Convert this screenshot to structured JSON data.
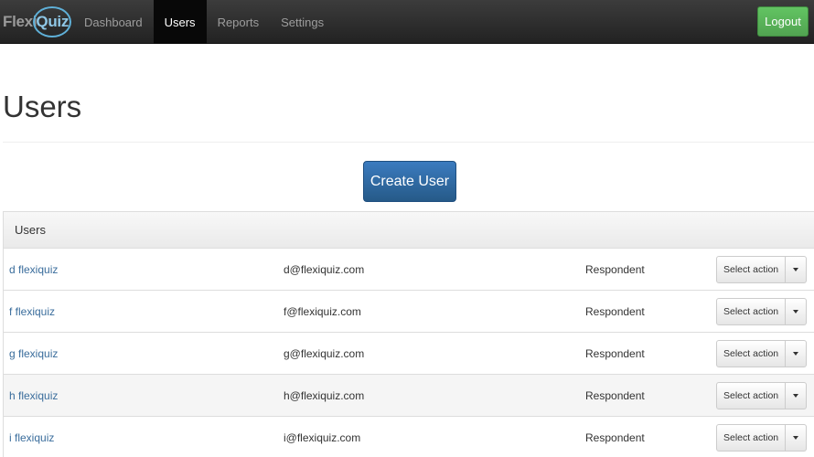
{
  "navbar": {
    "brand_part1": "Flexi",
    "brand_part2": "Quiz",
    "items": [
      {
        "label": "Dashboard",
        "active": false
      },
      {
        "label": "Users",
        "active": true
      },
      {
        "label": "Reports",
        "active": false
      },
      {
        "label": "Settings",
        "active": false
      }
    ],
    "logout_label": "Logout"
  },
  "page": {
    "title": "Users",
    "create_button": "Create User"
  },
  "panel": {
    "heading": "Users",
    "rows": [
      {
        "name": "d flexiquiz",
        "email": "d@flexiquiz.com",
        "role": "Respondent",
        "action": "Select action"
      },
      {
        "name": "f flexiquiz",
        "email": "f@flexiquiz.com",
        "role": "Respondent",
        "action": "Select action"
      },
      {
        "name": "g flexiquiz",
        "email": "g@flexiquiz.com",
        "role": "Respondent",
        "action": "Select action"
      },
      {
        "name": "h flexiquiz",
        "email": "h@flexiquiz.com",
        "role": "Respondent",
        "action": "Select action"
      },
      {
        "name": "i flexiquiz",
        "email": "i@flexiquiz.com",
        "role": "Respondent",
        "action": "Select action"
      }
    ]
  },
  "colors": {
    "navbar": "#222222",
    "link": "#3a6d9c",
    "primary_button": "#265a88",
    "logout_button": "#51a351"
  }
}
